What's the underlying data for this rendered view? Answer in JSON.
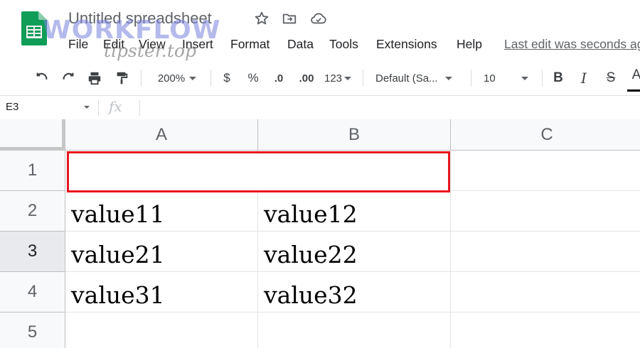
{
  "title_bar": {
    "doc_title": "Untitled spreadsheet",
    "icons": [
      "star-icon",
      "move-to-folder-icon",
      "cloud-status-icon"
    ]
  },
  "watermark": {
    "main": "WORKFLOW",
    "sub": "tipster.top"
  },
  "menu": {
    "items": [
      "File",
      "Edit",
      "View",
      "Insert",
      "Format",
      "Data",
      "Tools",
      "Extensions",
      "Help"
    ],
    "last_edit": "Last edit was seconds ago"
  },
  "toolbar": {
    "zoom": "200%",
    "currency": "$",
    "percent": "%",
    "decrease_decimal": ".0",
    "increase_decimal": ".00",
    "number_format": "123",
    "font": "Default (Sa...",
    "font_size": "10",
    "bold": "B",
    "italic": "I",
    "strikethrough": "S",
    "text_color": "A"
  },
  "formula_bar": {
    "cell_ref": "E3",
    "fx": "fx"
  },
  "grid": {
    "columns": [
      "A",
      "B",
      "C"
    ],
    "rows": [
      "1",
      "2",
      "3",
      "4",
      "5"
    ],
    "active_row": "3",
    "cells": [
      [
        "",
        "",
        ""
      ],
      [
        "value11",
        "value12",
        ""
      ],
      [
        "value21",
        "value22",
        ""
      ],
      [
        "value31",
        "value32",
        ""
      ],
      [
        "",
        "",
        ""
      ]
    ]
  },
  "colors": {
    "selection_border": "#e8171f",
    "sheets_green": "#0f9d58",
    "header_bg": "#f8f9fa"
  }
}
